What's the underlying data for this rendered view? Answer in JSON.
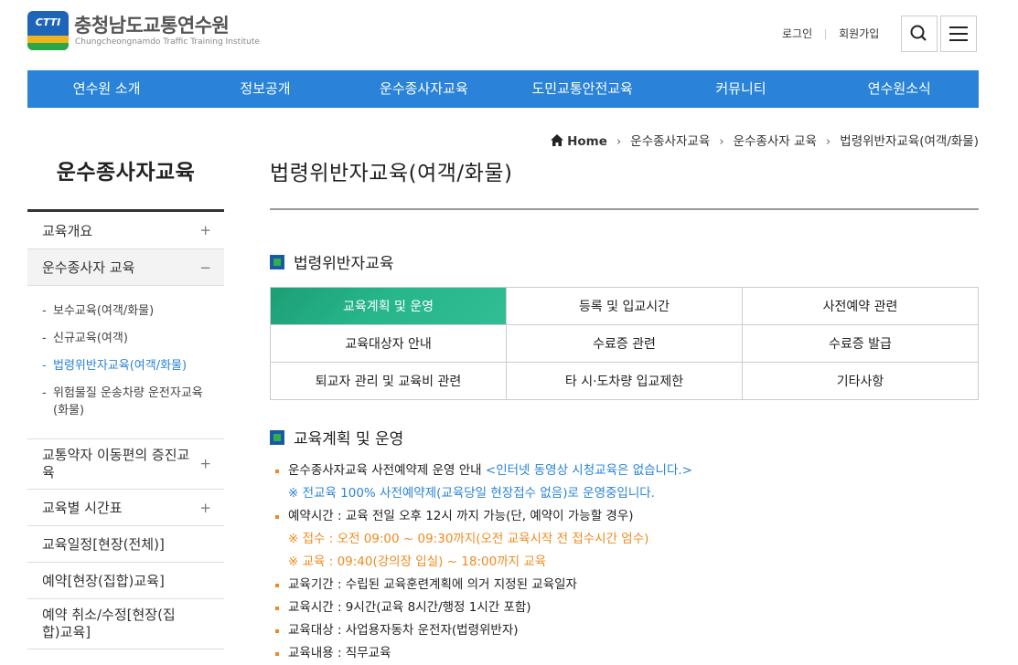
{
  "header": {
    "logo_mark": "CTTI",
    "logo_ko": "충청남도교통연수원",
    "logo_en": "Chungcheongnamdo Traffic Training Institute",
    "login": "로그인",
    "signup": "회원가입"
  },
  "nav": [
    "연수원 소개",
    "정보공개",
    "운수종사자교육",
    "도민교통안전교육",
    "커뮤니티",
    "연수원소식"
  ],
  "breadcrumb": {
    "home": "Home",
    "items": [
      "운수종사자교육",
      "운수종사자 교육",
      "법령위반자교육(여객/화물)"
    ]
  },
  "sidebar": {
    "title": "운수종사자교육",
    "items": [
      {
        "label": "교육개요",
        "mark": "+"
      },
      {
        "label": "운수종사자 교육",
        "mark": "−"
      },
      {
        "label": "교통약자 이동편의 증진교육",
        "mark": "+"
      },
      {
        "label": "교육별 시간표",
        "mark": "+"
      },
      {
        "label": "교육일정[현장(전체)]",
        "mark": ""
      },
      {
        "label": "예약[현장(집합)교육]",
        "mark": ""
      },
      {
        "label": "예약 취소/수정[현장(집합)교육]",
        "mark": ""
      }
    ],
    "sub": [
      "보수교육(여객/화물)",
      "신규교육(여객)",
      "법령위반자교육(여객/화물)",
      "위험물질 운송차량 운전자교육(화물)"
    ]
  },
  "main": {
    "title": "법령위반자교육(여객/화물)",
    "section1": "법령위반자교육",
    "tabs": [
      "교육계획 및 운영",
      "등록 및 입교시간",
      "사전예약 관련",
      "교육대상자 안내",
      "수료증 관련",
      "수료증 발급",
      "퇴교자 관리 및 교육비 관련",
      "타 시·도차량 입교제한",
      "기타사항"
    ],
    "section2": "교육계획 및 운영",
    "line1_a": "운수종사자교육 사전예약제 운영 안내 ",
    "line1_b": "<인터넷 동영상 시청교육은 없습니다.>",
    "line1_c": "※ 전교육 100% 사전예약제(교육당일 현장접수 없음)로 운영중입니다.",
    "line2": "예약시간 : 교육 전일 오후 12시 까지 가능(단, 예약이 가능할 경우)",
    "line2_a": "※ 접수 : 오전 09:00 ~ 09:30까지(오전 교육시작 전 접수시간 엄수)",
    "line2_b": "※ 교육 : 09:40(강의장 입실) ~ 18:00까지 교육",
    "line3": "교육기간 : 수립된 교육훈련계획에 의거 지정된 교육일자",
    "line4": "교육시간 : 9시간(교육 8시간/행정 1시간 포함)",
    "line5": "교육대상 : 사업용자동차 운전자(법령위반자)",
    "line6": "교육내용 : 직무교육"
  },
  "colors": {
    "nav": "#2a83d8",
    "active_tab": "#27b58a",
    "accent_orange": "#f08a1e"
  }
}
